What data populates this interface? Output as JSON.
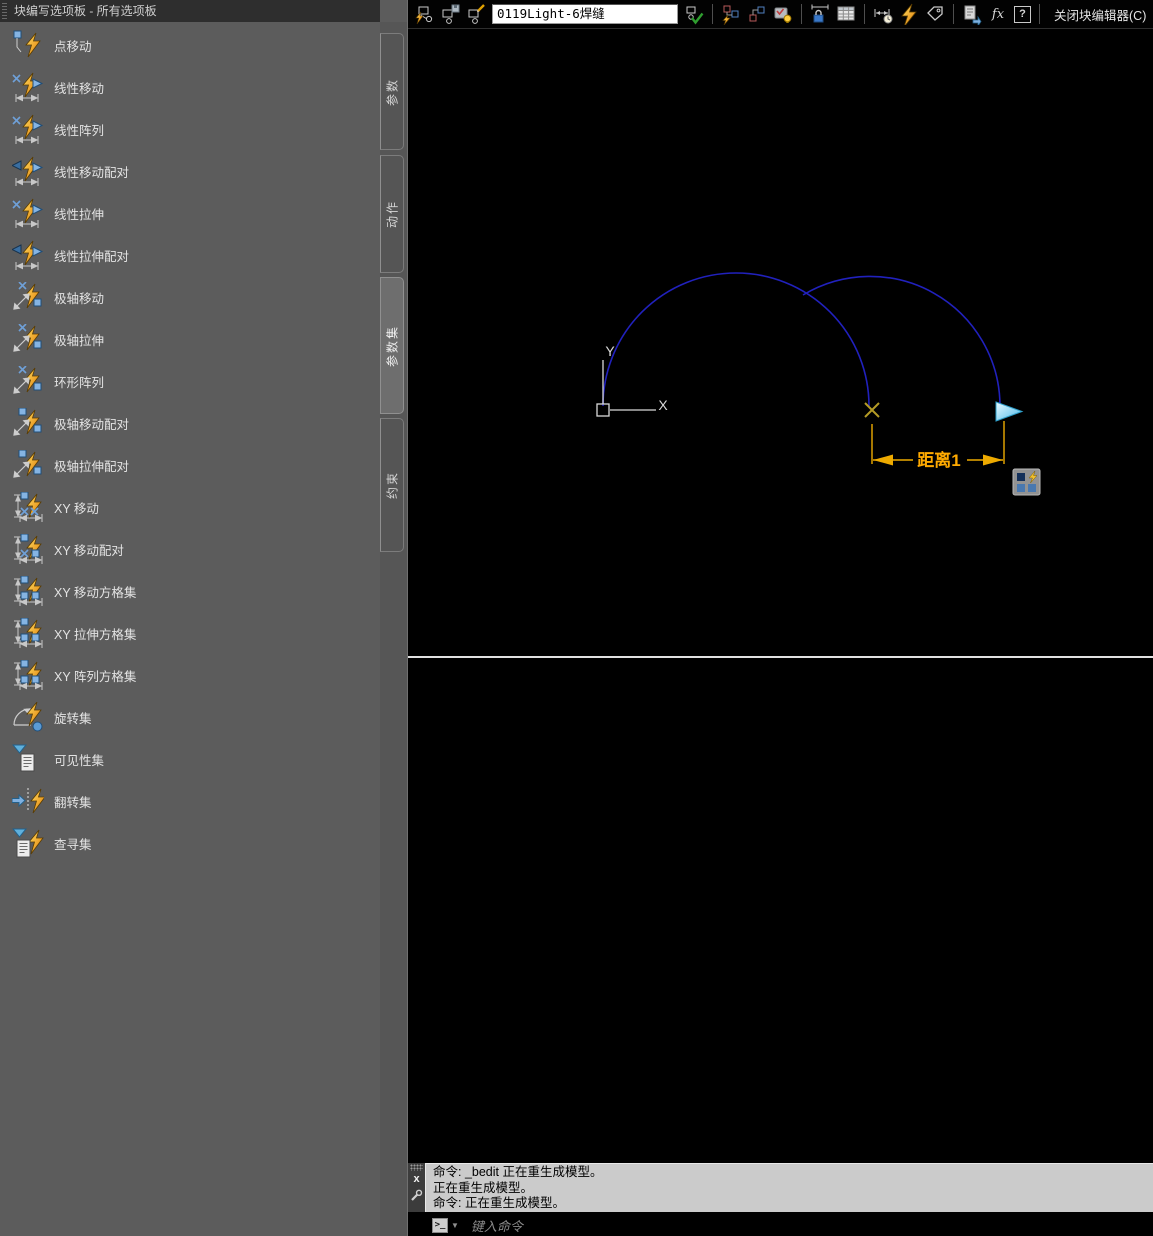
{
  "palette": {
    "title": "块编写选项板 - 所有选项板",
    "items": [
      {
        "label": "点移动",
        "icon": "point-move-icon"
      },
      {
        "label": "线性移动",
        "icon": "linear-move-icon"
      },
      {
        "label": "线性阵列",
        "icon": "linear-array-icon"
      },
      {
        "label": "线性移动配对",
        "icon": "linear-move-pair-icon"
      },
      {
        "label": "线性拉伸",
        "icon": "linear-stretch-icon"
      },
      {
        "label": "线性拉伸配对",
        "icon": "linear-stretch-pair-icon"
      },
      {
        "label": "极轴移动",
        "icon": "polar-move-icon"
      },
      {
        "label": "极轴拉伸",
        "icon": "polar-stretch-icon"
      },
      {
        "label": "环形阵列",
        "icon": "polar-array-icon"
      },
      {
        "label": "极轴移动配对",
        "icon": "polar-move-pair-icon"
      },
      {
        "label": "极轴拉伸配对",
        "icon": "polar-stretch-pair-icon"
      },
      {
        "label": "XY 移动",
        "icon": "xy-move-icon"
      },
      {
        "label": "XY 移动配对",
        "icon": "xy-move-pair-icon"
      },
      {
        "label": "XY 移动方格集",
        "icon": "xy-move-boxset-icon"
      },
      {
        "label": "XY 拉伸方格集",
        "icon": "xy-stretch-boxset-icon"
      },
      {
        "label": "XY 阵列方格集",
        "icon": "xy-array-boxset-icon"
      },
      {
        "label": "旋转集",
        "icon": "rotation-set-icon"
      },
      {
        "label": "可见性集",
        "icon": "visibility-set-icon"
      },
      {
        "label": "翻转集",
        "icon": "flip-set-icon"
      },
      {
        "label": "查寻集",
        "icon": "lookup-set-icon"
      }
    ],
    "tabs": [
      {
        "label": "参数",
        "active": false
      },
      {
        "label": "动作",
        "active": false
      },
      {
        "label": "参数集",
        "active": true
      },
      {
        "label": "约束",
        "active": false
      }
    ]
  },
  "toolbar": {
    "block_name": "0119Light-6焊缝",
    "fx_label": "fx",
    "help_label": "?",
    "close_label": "关闭块编辑器(C)",
    "icons": [
      "edit-block-icon",
      "save-block-icon",
      "write-block-icon",
      "test-block-icon",
      "authoring-palettes-icon",
      "parameters-icon",
      "highlight-lightbulb-icon",
      "constraint-lock-icon",
      "block-table-icon",
      "parameter-dimension-icon",
      "action-bolt-icon",
      "attribute-tag-icon",
      "visibility-states-icon",
      "fx-icon",
      "help-icon"
    ]
  },
  "drawing": {
    "dimension_label": "距离1",
    "ucs": {
      "x_label": "X",
      "y_label": "Y"
    },
    "colors": {
      "arc": "#2121bd",
      "dimension": "#edaa00",
      "dimension_text": "#ffaa00",
      "basepoint_x": "#b49b25",
      "flip_grip": "#7fd0ef",
      "ucs": "#d9d9d9",
      "divider_line": "#e0e0e0"
    }
  },
  "command": {
    "history": [
      "命令: _bedit 正在重生成模型。",
      "正在重生成模型。",
      "命令: 正在重生成模型。"
    ],
    "prompt_symbol": ">_",
    "input_placeholder": "键入命令"
  }
}
